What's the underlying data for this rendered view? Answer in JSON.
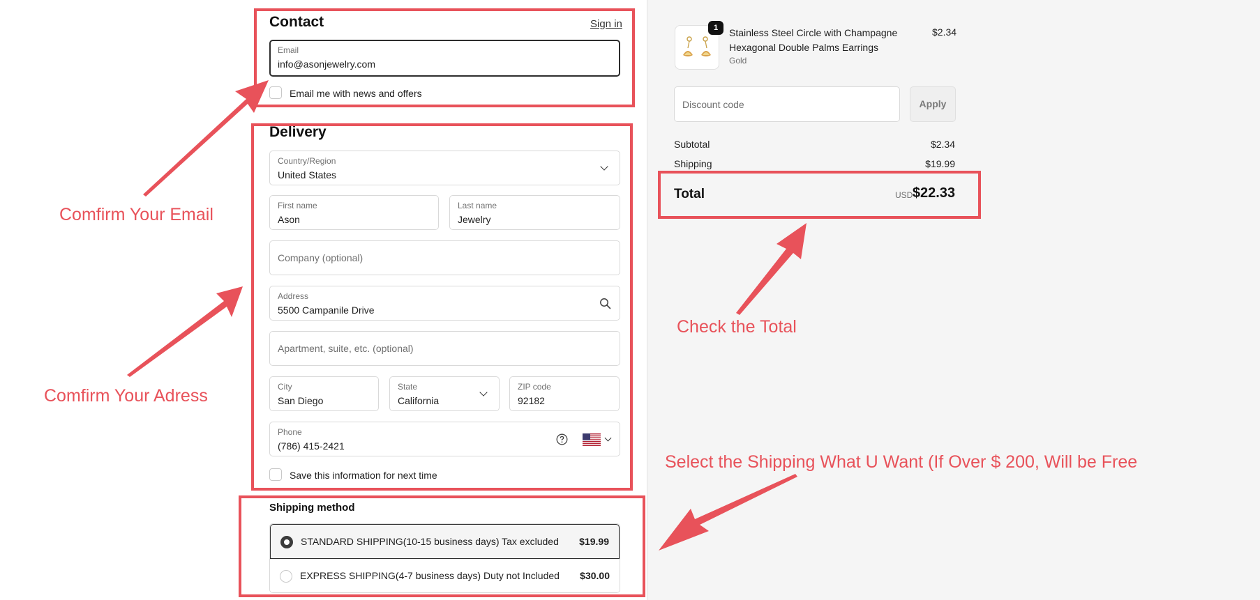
{
  "contact": {
    "title": "Contact",
    "sign_in": "Sign in",
    "email_label": "Email",
    "email_value": "info@asonjewelry.com",
    "newsletter_label": "Email me with news and offers"
  },
  "delivery": {
    "title": "Delivery",
    "country_label": "Country/Region",
    "country_value": "United States",
    "first_name_label": "First name",
    "first_name_value": "Ason",
    "last_name_label": "Last name",
    "last_name_value": "Jewelry",
    "company_placeholder": "Company (optional)",
    "address_label": "Address",
    "address_value": "5500 Campanile Drive",
    "apartment_placeholder": "Apartment, suite, etc. (optional)",
    "city_label": "City",
    "city_value": "San Diego",
    "state_label": "State",
    "state_value": "California",
    "zip_label": "ZIP code",
    "zip_value": "92182",
    "phone_label": "Phone",
    "phone_value": "(786) 415-2421",
    "save_info_label": "Save this information for next time"
  },
  "shipping": {
    "title": "Shipping method",
    "options": [
      {
        "name": "STANDARD SHIPPING(10-15 business days) Tax excluded",
        "price": "$19.99",
        "selected": true
      },
      {
        "name": "EXPRESS SHIPPING(4-7 business days) Duty not Included",
        "price": "$30.00",
        "selected": false
      }
    ]
  },
  "order": {
    "product_name": "Stainless Steel Circle with Champagne Hexagonal Double Palms Earrings",
    "product_variant": "Gold",
    "product_price": "$2.34",
    "quantity": "1",
    "discount_placeholder": "Discount code",
    "apply_label": "Apply",
    "subtotal_label": "Subtotal",
    "subtotal_value": "$2.34",
    "shipping_label": "Shipping",
    "shipping_value": "$19.99",
    "total_label": "Total",
    "total_currency": "USD",
    "total_value": "$22.33"
  },
  "annotations": {
    "email": "Comfirm Your Email",
    "address": "Comfirm Your Adress",
    "total": "Check the Total",
    "shipping": "Select the Shipping What U Want  (If Over  $ 200, Will be Free"
  },
  "colors": {
    "annotation": "#e8525a",
    "focus_border": "#2d2d2d",
    "summary_background": "#f5f5f5"
  },
  "icons": {
    "address_search": "search-icon",
    "phone_help": "help-circle-icon",
    "phone_country": "us-flag-icon",
    "product": "earrings-product-image"
  }
}
